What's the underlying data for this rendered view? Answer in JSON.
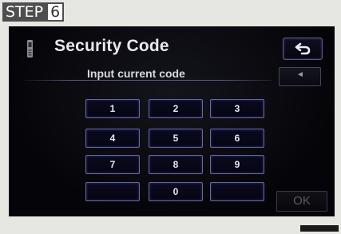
{
  "step": {
    "label": "STEP",
    "number": "6"
  },
  "screen": {
    "title": "Security Code",
    "prompt": "Input current code",
    "back_icon": "return-arrow-icon",
    "delete_icon": "delete-arrow-icon",
    "delete_glyph": "◄",
    "keys": [
      "1",
      "2",
      "3",
      "4",
      "5",
      "6",
      "7",
      "8",
      "9",
      "",
      "0",
      ""
    ],
    "ok_label": "OK"
  },
  "colors": {
    "screen_bg": "#050509",
    "key_border": "#6668a6",
    "text": "#e8e8ee",
    "disabled_text": "#5c5c66"
  }
}
